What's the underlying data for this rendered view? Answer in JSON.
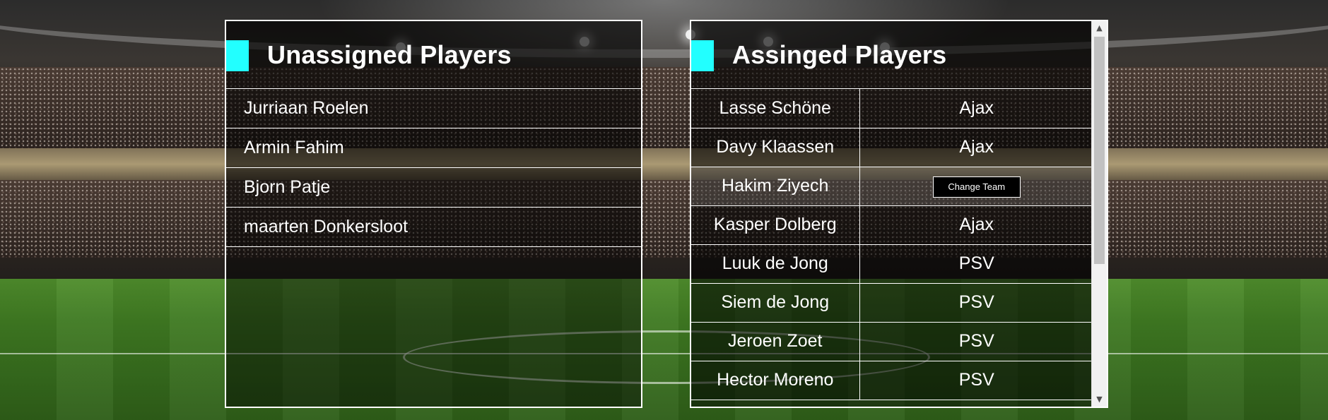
{
  "unassigned": {
    "title": "Unassigned Players",
    "players": [
      "Jurriaan Roelen",
      "Armin Fahim",
      "Bjorn Patje",
      "maarten Donkersloot"
    ]
  },
  "assigned": {
    "title": "Assinged Players",
    "change_team_label": "Change Team",
    "rows": [
      {
        "name": "Lasse Schöne",
        "team": "Ajax"
      },
      {
        "name": "Davy Klaassen",
        "team": "Ajax"
      },
      {
        "name": "Hakim Ziyech",
        "team": ""
      },
      {
        "name": "Kasper Dolberg",
        "team": "Ajax"
      },
      {
        "name": "Luuk de Jong",
        "team": "PSV"
      },
      {
        "name": "Siem de Jong",
        "team": "PSV"
      },
      {
        "name": "Jeroen Zoet",
        "team": "PSV"
      },
      {
        "name": "Hector Moreno",
        "team": "PSV"
      }
    ]
  },
  "scrollbar": {
    "up_icon": "▲",
    "down_icon": "▼"
  },
  "colors": {
    "accent": "#22ffff",
    "border": "#ffffff"
  }
}
